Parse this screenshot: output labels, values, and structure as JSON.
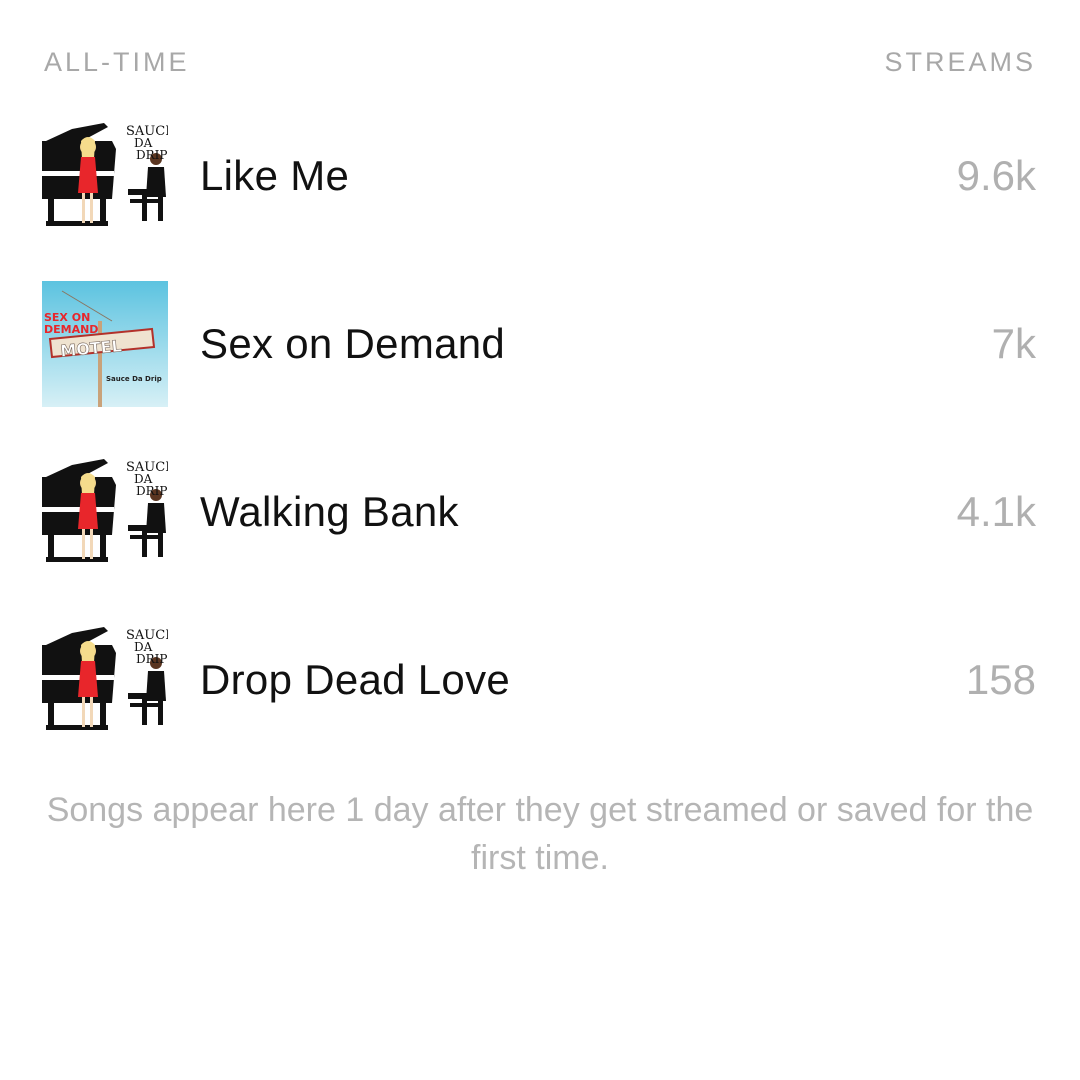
{
  "header": {
    "left_label": "ALL-TIME",
    "right_label": "STREAMS"
  },
  "songs": [
    {
      "title": "Like Me",
      "streams": "9.6k",
      "artwork": {
        "icon": "piano-album-art-icon",
        "text_lines": [
          "SAUCE",
          "DA",
          "DRIP"
        ]
      }
    },
    {
      "title": "Sex on Demand",
      "streams": "7k",
      "artwork": {
        "icon": "motel-album-art-icon",
        "headline_lines": [
          "SEX ON",
          "DEMAND"
        ],
        "sign_text": "MOTEL",
        "artist_text": "Sauce Da Drip"
      }
    },
    {
      "title": "Walking Bank",
      "streams": "4.1k",
      "artwork": {
        "icon": "piano-album-art-icon",
        "text_lines": [
          "SAUCE",
          "DA",
          "DRIP"
        ]
      }
    },
    {
      "title": "Drop Dead Love",
      "streams": "158",
      "artwork": {
        "icon": "piano-album-art-icon",
        "text_lines": [
          "SAUCE",
          "DA",
          "DRIP"
        ]
      }
    }
  ],
  "footer": {
    "note": "Songs appear here 1 day after they get streamed or saved for the first time."
  },
  "colors": {
    "text_primary": "#111111",
    "text_secondary": "#a8a8a8",
    "background": "#ffffff",
    "dress_red": "#e8262b",
    "sky_blue": "#7fd0e6"
  }
}
